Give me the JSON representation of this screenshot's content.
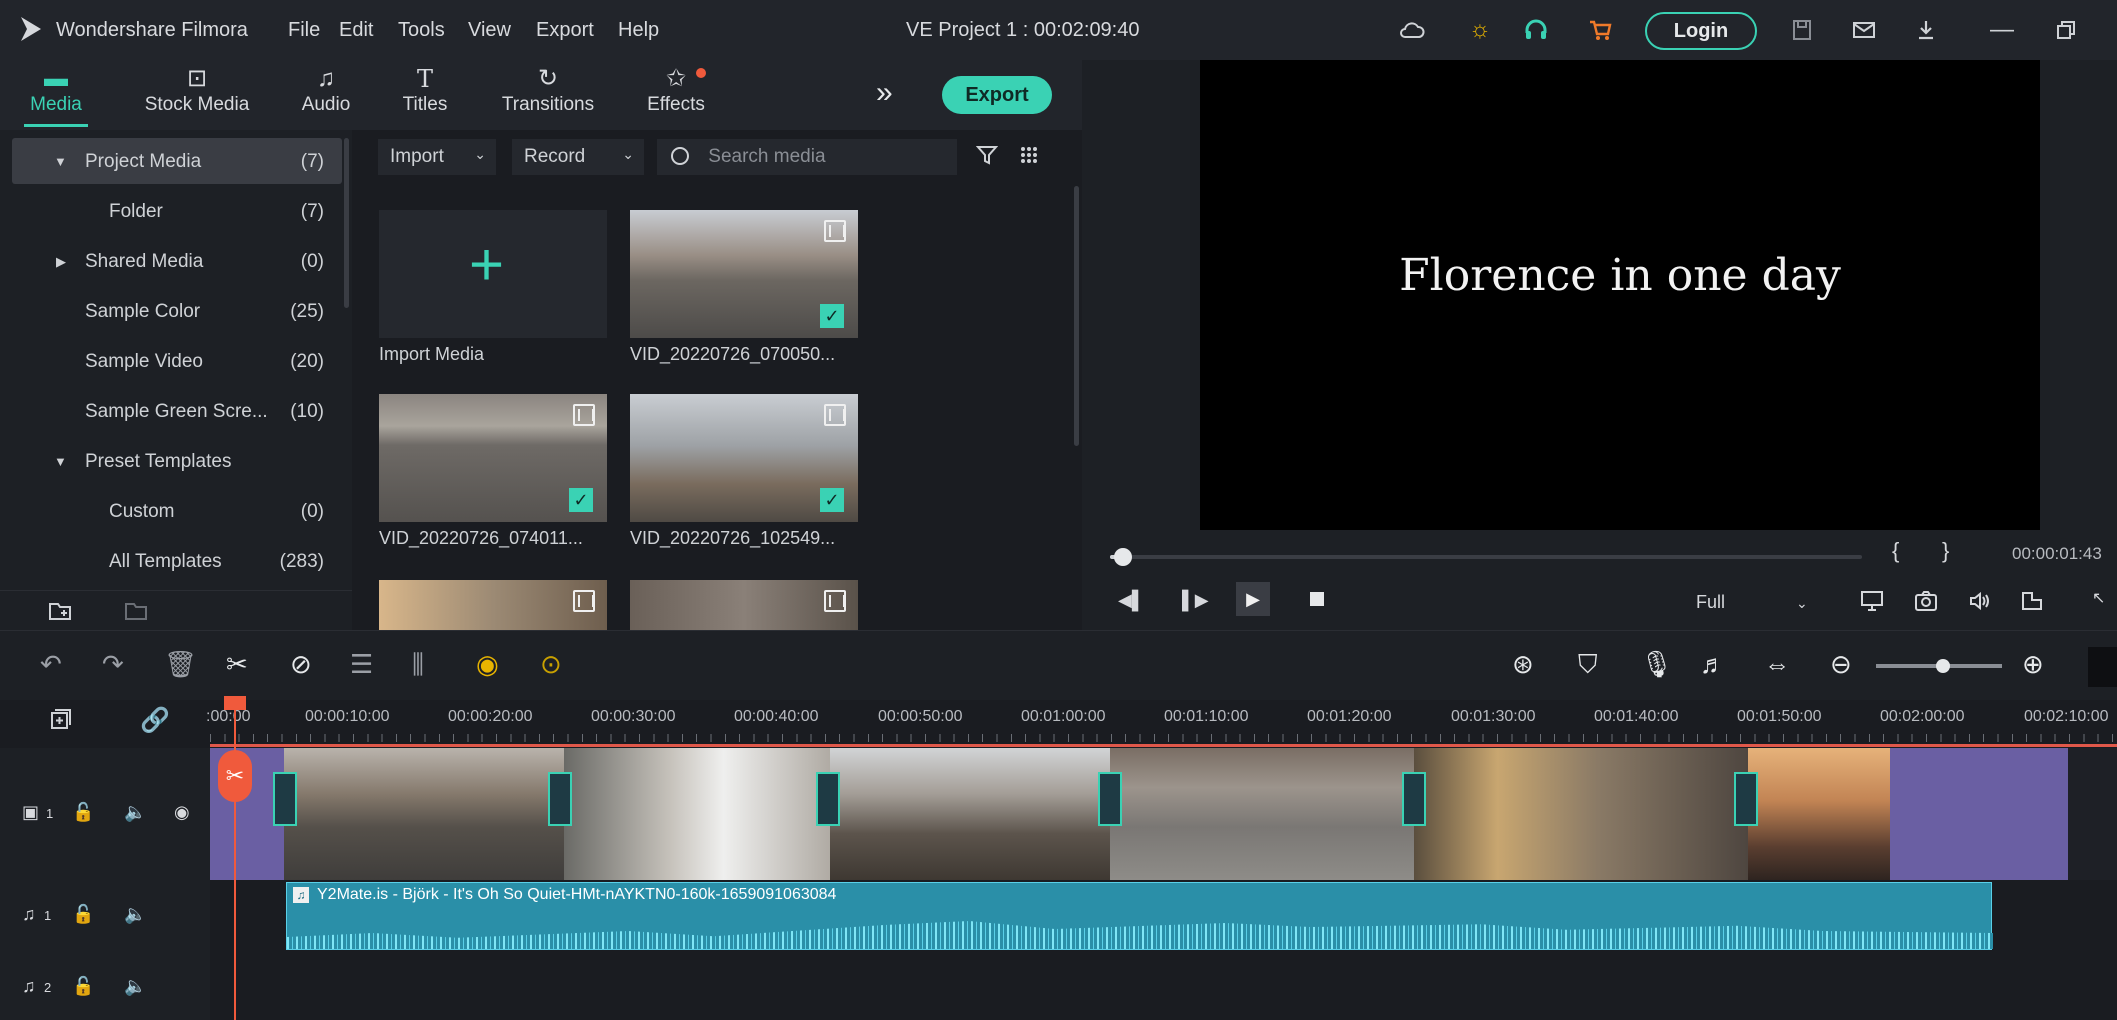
{
  "app": {
    "name": "Wondershare Filmora",
    "project_title": "VE Project 1 : 00:02:09:40",
    "menu": [
      "File",
      "Edit",
      "Tools",
      "View",
      "Export",
      "Help"
    ],
    "login_label": "Login"
  },
  "library": {
    "tabs": [
      {
        "label": "Media",
        "icon": "folder-icon",
        "active": true
      },
      {
        "label": "Stock Media",
        "icon": "stock-media-icon"
      },
      {
        "label": "Audio",
        "icon": "music-note-icon"
      },
      {
        "label": "Titles",
        "icon": "text-t-icon"
      },
      {
        "label": "Transitions",
        "icon": "transitions-icon"
      },
      {
        "label": "Effects",
        "icon": "effects-icon"
      }
    ],
    "more_label": "»",
    "export_label": "Export"
  },
  "sidebar": {
    "items": [
      {
        "label": "Project Media",
        "count": "(7)",
        "expander": "▼"
      },
      {
        "label": "Folder",
        "count": "(7)"
      },
      {
        "label": "Shared Media",
        "count": "(0)",
        "expander": "▶"
      },
      {
        "label": "Sample Color",
        "count": "(25)"
      },
      {
        "label": "Sample Video",
        "count": "(20)"
      },
      {
        "label": "Sample Green Scre...",
        "count": "(10)"
      },
      {
        "label": "Preset Templates",
        "expander": "▼"
      },
      {
        "label": "Custom",
        "count": "(0)"
      },
      {
        "label": "All Templates",
        "count": "(283)"
      }
    ]
  },
  "media": {
    "import_label": "Import",
    "record_label": "Record",
    "search_placeholder": "Search media",
    "import_media_label": "Import Media",
    "clips": [
      {
        "label": "VID_20220726_070050..."
      },
      {
        "label": "VID_20220726_074011..."
      },
      {
        "label": "VID_20220726_102549..."
      }
    ]
  },
  "preview": {
    "viewer_text": "Florence in one day",
    "timecode": "00:00:01:43",
    "mark_in": "{",
    "mark_out": "}",
    "quality": "Full",
    "progress_fraction": 0.01
  },
  "timeline": {
    "ruler_labels": [
      ":00:00",
      "00:00:10:00",
      "00:00:20:00",
      "00:00:30:00",
      "00:00:40:00",
      "00:00:50:00",
      "00:01:00:00",
      "00:01:10:00",
      "00:01:20:00",
      "00:01:30:00",
      "00:01:40:00",
      "00:01:50:00",
      "00:02:00:00",
      "00:02:10:00"
    ],
    "tracks": [
      {
        "name": "video-1",
        "number": "1"
      },
      {
        "name": "audio-1",
        "number": "1"
      },
      {
        "name": "audio-2",
        "number": "2"
      }
    ],
    "audio_clip_label": "Y2Mate.is - Björk - It's Oh So Quiet-HMt-nAYKTN0-160k-1659091063084"
  },
  "colors": {
    "accent": "#3ad2b4",
    "playhead": "#f05a3c",
    "video_track": "#6a5fa3",
    "audio_track": "#2a8fa8"
  }
}
